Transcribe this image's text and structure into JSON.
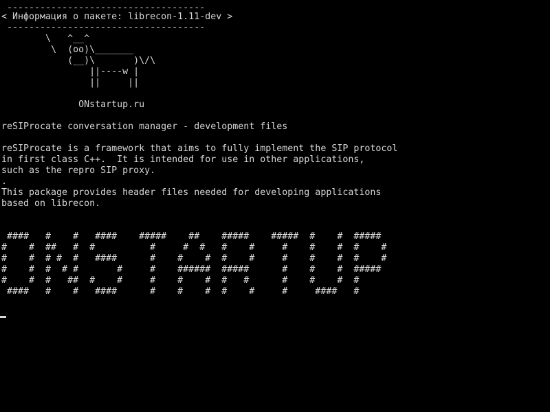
{
  "terminal": {
    "cowsay": {
      "border_top": " ------------------------------------",
      "message": "< Информация о пакете: librecon-1.11-dev >",
      "border_bottom": " ------------------------------------",
      "cow_line_1": "        \\   ^__^",
      "cow_line_2": "         \\  (oo)\\_______",
      "cow_line_3": "            (__)\\       )\\/\\",
      "cow_line_4": "                ||----w |",
      "cow_line_5": "                ||     ||"
    },
    "site": "              ONstartup.ru",
    "package_summary": "reSIProcate conversation manager - development files",
    "description_lines": [
      "reSIProcate is a framework that aims to fully implement the SIP protocol",
      "in first class C++.  It is intended for use in other applications,",
      "such as the repro SIP proxy.",
      ".",
      "This package provides header files needed for developing applications",
      "based on librecon."
    ],
    "banner_lines": [
      " ####   #    #   ####    #####    ##    #####    #####  #    #  #####",
      "#    #  ##   #  #          #     #  #   #    #     #    #    #  #    #",
      "#    #  # #  #   ####      #    #    #  #    #     #    #    #  #    #",
      "#    #  #  # #       #     #    ######  #####      #    #    #  #####",
      "#    #  #   ##  #    #     #    #    #  #   #      #    #    #  #",
      " ####   #    #   ####      #    #    #  #    #     #     ####   #"
    ]
  }
}
